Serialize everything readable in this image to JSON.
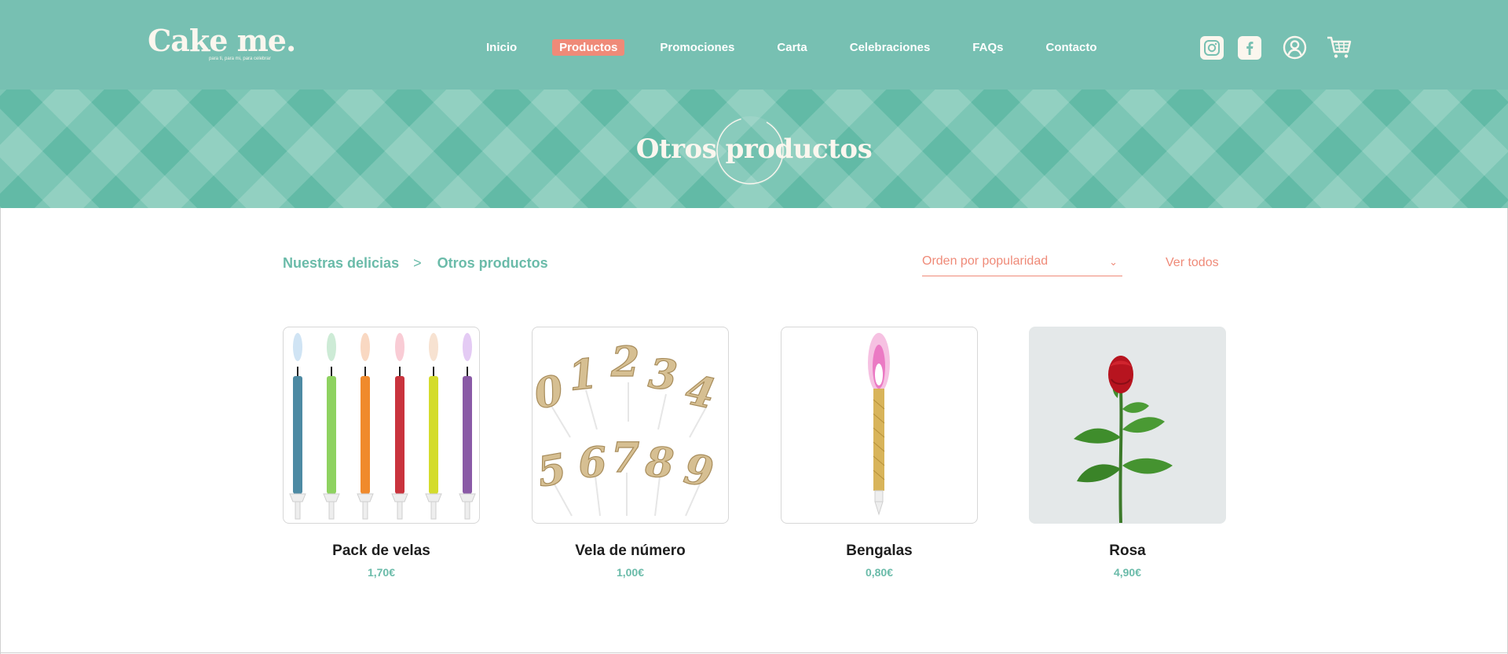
{
  "header": {
    "logo": "Cake me.",
    "tagline": "para ti, para mi, para celebrar",
    "nav": [
      {
        "label": "Inicio",
        "active": false
      },
      {
        "label": "Productos",
        "active": true
      },
      {
        "label": "Promociones",
        "active": false
      },
      {
        "label": "Carta",
        "active": false
      },
      {
        "label": "Celebraciones",
        "active": false
      },
      {
        "label": "FAQs",
        "active": false
      },
      {
        "label": "Contacto",
        "active": false
      }
    ],
    "icons": [
      "instagram-icon",
      "facebook-icon",
      "user-icon",
      "cart-icon"
    ]
  },
  "banner": {
    "title": "Otros productos"
  },
  "breadcrumb": {
    "parent": "Nuestras delicias",
    "separator": ">",
    "current": "Otros productos"
  },
  "sort": {
    "selected": "Orden por popularidad"
  },
  "view_all": "Ver todos",
  "products": [
    {
      "name": "Pack de velas",
      "price": "1,70€"
    },
    {
      "name": "Vela de número",
      "price": "1,00€"
    },
    {
      "name": "Bengalas",
      "price": "0,80€"
    },
    {
      "name": "Rosa",
      "price": "4,90€"
    }
  ],
  "colors": {
    "header_bg": "#77c0b2",
    "accent_coral": "#ef8a78",
    "accent_green": "#6abba9",
    "cream": "#fbf6ee"
  }
}
